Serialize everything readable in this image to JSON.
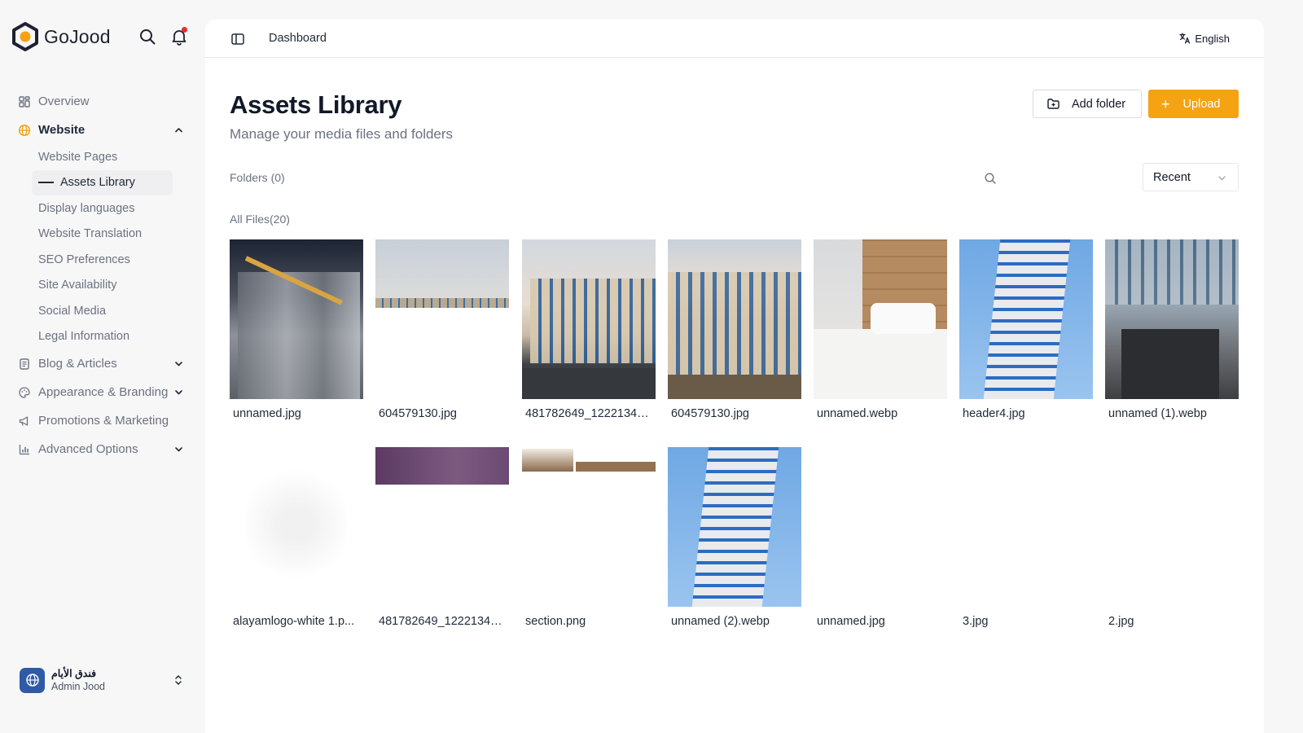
{
  "brand": {
    "name": "GoJood"
  },
  "sidebar": {
    "nav": [
      {
        "label": "Overview"
      },
      {
        "label": "Website"
      },
      {
        "label": "Blog & Articles"
      },
      {
        "label": "Appearance & Branding"
      },
      {
        "label": "Promotions & Marketing"
      },
      {
        "label": "Advanced Options"
      }
    ],
    "website_sub": [
      {
        "label": "Website Pages"
      },
      {
        "label": "Assets Library"
      },
      {
        "label": "Display languages"
      },
      {
        "label": "Website Translation"
      },
      {
        "label": "SEO Preferences"
      },
      {
        "label": "Site Availability"
      },
      {
        "label": "Social Media"
      },
      {
        "label": "Legal Information"
      }
    ],
    "user": {
      "name": "فندق الأيام",
      "role": "Admin Jood"
    }
  },
  "topbar": {
    "breadcrumb": "Dashboard",
    "language": "English"
  },
  "page": {
    "title": "Assets Library",
    "subtitle": "Manage your media files and folders",
    "add_folder_label": "Add folder",
    "upload_label": "Upload",
    "folders_label": "Folders (0)",
    "files_label": "All Files(20)",
    "sort_value": "Recent"
  },
  "files": [
    {
      "name": "unnamed.jpg",
      "thumb": "night"
    },
    {
      "name": "604579130.jpg",
      "thumb": "sky-cut"
    },
    {
      "name": "481782649_12221344...",
      "thumb": "hotel"
    },
    {
      "name": "604579130.jpg",
      "thumb": "hotel2"
    },
    {
      "name": "unnamed.webp",
      "thumb": "room"
    },
    {
      "name": "header4.jpg",
      "thumb": "tower"
    },
    {
      "name": "unnamed (1).webp",
      "thumb": "storefront"
    },
    {
      "name": "alayamlogo-white 1.p...",
      "thumb": "logo"
    },
    {
      "name": "481782649_12221344...",
      "thumb": "purple"
    },
    {
      "name": "section.png",
      "thumb": "section"
    },
    {
      "name": "unnamed (2).webp",
      "thumb": "tower"
    },
    {
      "name": "unnamed.jpg",
      "thumb": "blank"
    },
    {
      "name": "3.jpg",
      "thumb": "blank"
    },
    {
      "name": "2.jpg",
      "thumb": "blank"
    }
  ],
  "colors": {
    "accent": "#f5a213",
    "avatar": "#2e5aa6",
    "notification": "#ef2a2a"
  }
}
